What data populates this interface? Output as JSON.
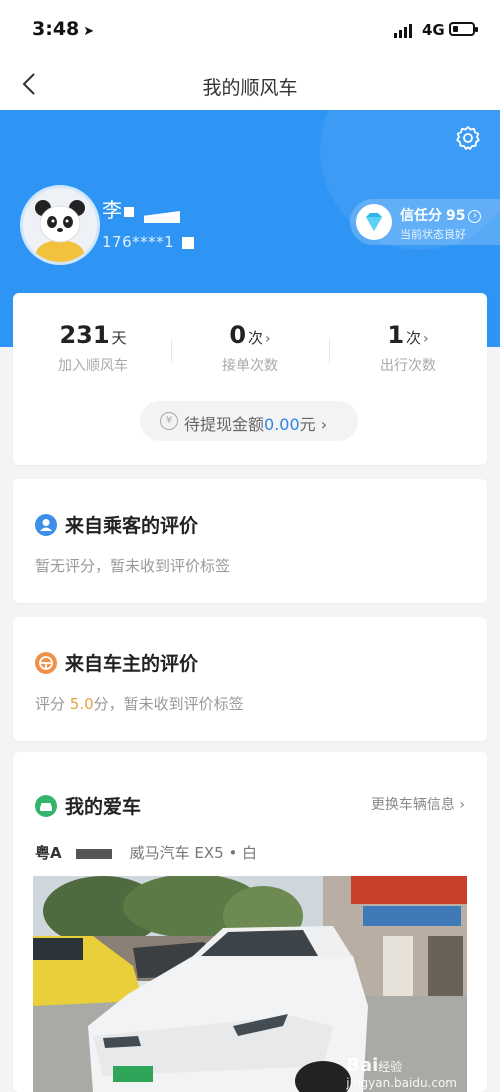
{
  "status_bar": {
    "time": "3:48",
    "network": "4G"
  },
  "nav": {
    "title": "我的顺风车"
  },
  "profile": {
    "name": "李",
    "phone": "176****1",
    "credit_label": "信任分",
    "credit_score": "95",
    "credit_status": "当前状态良好"
  },
  "stats": [
    {
      "value": "231",
      "unit": "天",
      "label": "加入顺风车",
      "arrow": ""
    },
    {
      "value": "0",
      "unit": "次",
      "label": "接单次数",
      "arrow": "›"
    },
    {
      "value": "1",
      "unit": "次",
      "label": "出行次数",
      "arrow": "›"
    }
  ],
  "withdraw": {
    "prefix": "待提现金额",
    "amount": "0.00",
    "suffix": "元 ›"
  },
  "passenger_eval": {
    "title": "来自乘客的评价",
    "desc": "暂无评分，暂未收到评价标签"
  },
  "owner_eval": {
    "title": "来自车主的评价",
    "desc_prefix": "评分 ",
    "score": "5.0",
    "desc_suffix": "分，暂未收到评价标签"
  },
  "car": {
    "title": "我的爱车",
    "change": "更换车辆信息 ›",
    "plate_prefix": "粤A",
    "model": "威马汽车 EX5 • 白"
  },
  "watermark": {
    "brand": "Bai",
    "suffix": "经验",
    "url": "jingyan.baidu.com"
  },
  "colors": {
    "primary_blue": "#2f95f5",
    "accent_orange": "#e0a33a",
    "green": "#35b56c",
    "amount_blue": "#2f86e0"
  }
}
